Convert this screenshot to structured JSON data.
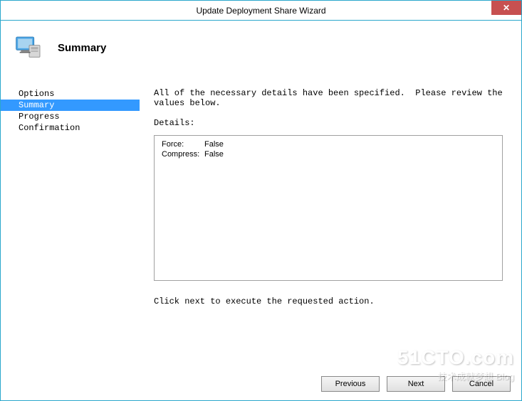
{
  "window": {
    "title": "Update Deployment Share Wizard"
  },
  "header": {
    "title": "Summary"
  },
  "sidebar": {
    "items": [
      {
        "label": "Options",
        "selected": false
      },
      {
        "label": "Summary",
        "selected": true
      },
      {
        "label": "Progress",
        "selected": false
      },
      {
        "label": "Confirmation",
        "selected": false
      }
    ]
  },
  "panel": {
    "intro": "All of the necessary details have been specified.  Please review the values below.",
    "details_label": "Details:",
    "details": [
      {
        "key": "Force:",
        "value": "False"
      },
      {
        "key": "Compress:",
        "value": "False"
      }
    ],
    "footer": "Click next to execute the requested action."
  },
  "buttons": {
    "previous": "Previous",
    "next": "Next",
    "cancel": "Cancel"
  },
  "watermark": {
    "line1": "51CTO.com",
    "line2": "技术成就梦想 Blog"
  }
}
